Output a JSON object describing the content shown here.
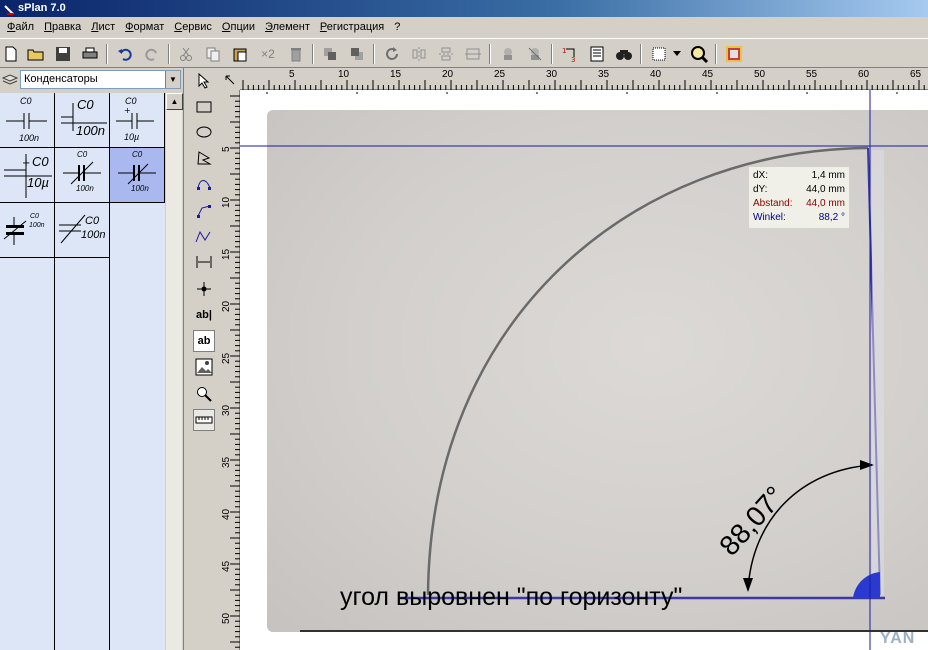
{
  "window": {
    "title": "sPlan 7.0"
  },
  "menu": {
    "items": [
      "Файл",
      "Правка",
      "Лист",
      "Формат",
      "Сервис",
      "Опции",
      "Элемент",
      "Регистрация",
      "?"
    ]
  },
  "toolbar": {
    "x2_label": "×2"
  },
  "library": {
    "selected": "Конденсаторы",
    "parts": [
      {
        "top": "C0",
        "bottom": "100n"
      },
      {
        "top": "C0",
        "bottom": "100n"
      },
      {
        "top": "C0",
        "bottom": "10µ"
      },
      {
        "top": "C0",
        "bottom": "10µ"
      },
      {
        "top": "C0",
        "bottom": "100n"
      },
      {
        "top": "C0",
        "bottom": "100n"
      },
      {
        "top": "C0",
        "bottom": "100n"
      },
      {
        "top": "C0",
        "bottom": "100n"
      }
    ]
  },
  "tools": {
    "text_label": "ab|",
    "textbox_label": "ab"
  },
  "ruler": {
    "top": [
      "5",
      "10",
      "15",
      "20",
      "25",
      "30",
      "35",
      "40",
      "45",
      "50",
      "55",
      "60",
      "65"
    ],
    "left": [
      "5",
      "10",
      "15",
      "20",
      "25",
      "30",
      "35",
      "40",
      "45",
      "50"
    ]
  },
  "measure": {
    "dx_label": "dX:",
    "dx_value": "1,4 mm",
    "dy_label": "dY:",
    "dy_value": "44,0 mm",
    "dist_label": "Abstand:",
    "dist_value": "44,0 mm",
    "angle_label": "Winkel:",
    "angle_value": "88,2 °"
  },
  "drawing": {
    "angle_text": "88,07°",
    "caption": "угол выровнен \"по горизонту\"",
    "watermark": "YAN"
  },
  "colors": {
    "selection": "#aab8f0",
    "parts_bg": "#dce6f6",
    "guide": "#1a1aa0"
  }
}
